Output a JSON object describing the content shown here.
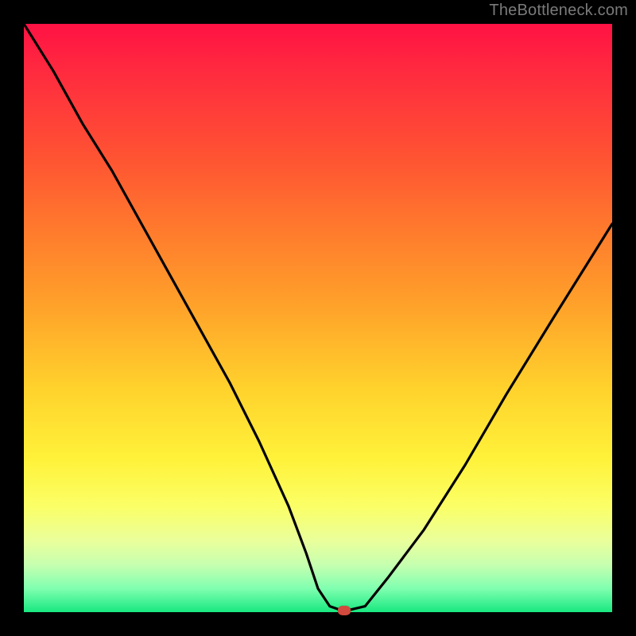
{
  "watermark": "TheBottleneck.com",
  "chart_data": {
    "type": "line",
    "title": "",
    "xlabel": "",
    "ylabel": "",
    "xlim": [
      0,
      100
    ],
    "ylim": [
      0,
      100
    ],
    "x": [
      0,
      5,
      10,
      15,
      20,
      25,
      30,
      35,
      40,
      45,
      48,
      50,
      52,
      54,
      55,
      58,
      62,
      68,
      75,
      82,
      90,
      100
    ],
    "values": [
      100,
      92,
      83,
      75,
      66,
      57,
      48,
      39,
      29,
      18,
      10,
      4,
      1,
      0.3,
      0.3,
      1,
      6,
      14,
      25,
      37,
      50,
      66
    ],
    "series": [
      {
        "name": "bottleneck-curve",
        "x": [
          0,
          5,
          10,
          15,
          20,
          25,
          30,
          35,
          40,
          45,
          48,
          50,
          52,
          54,
          55,
          58,
          62,
          68,
          75,
          82,
          90,
          100
        ],
        "values": [
          100,
          92,
          83,
          75,
          66,
          57,
          48,
          39,
          29,
          18,
          10,
          4,
          1,
          0.3,
          0.3,
          1,
          6,
          14,
          25,
          37,
          50,
          66
        ]
      }
    ],
    "marker": {
      "x": 54.5,
      "y": 0.3
    },
    "grid": false,
    "legend": false
  }
}
